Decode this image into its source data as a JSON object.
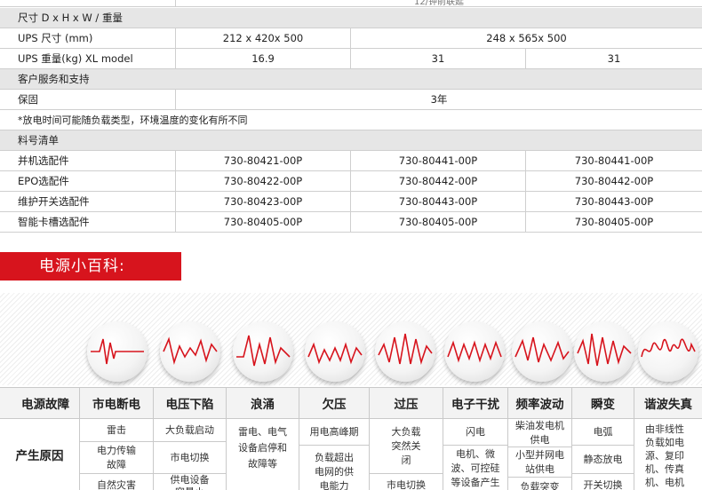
{
  "spec_table": {
    "top_partial": "12/钟前联延",
    "section_dims": "尺寸 D x H x W / 重量",
    "ups_size": {
      "label": "UPS 尺寸 (mm)",
      "v1": "212 x 420x 500",
      "v2": "248 x 565x 500"
    },
    "ups_weight": {
      "label": "UPS 重量(kg) XL model",
      "v1": "16.9",
      "v2": "31",
      "v3": "31"
    },
    "section_service": "客户服务和支持",
    "warranty": {
      "label": "保固",
      "value": "3年"
    },
    "note": "*放电时间可能随负载类型，环境温度的变化有所不同",
    "section_parts": "料号清单",
    "parts": [
      {
        "label": "并机选配件",
        "v1": "730-80421-00P",
        "v2": "730-80441-00P",
        "v3": "730-80441-00P"
      },
      {
        "label": "EPO选配件",
        "v1": "730-80422-00P",
        "v2": "730-80442-00P",
        "v3": "730-80442-00P"
      },
      {
        "label": "维护开关选配件",
        "v1": "730-80423-00P",
        "v2": "730-80443-00P",
        "v3": "730-80443-00P"
      },
      {
        "label": "智能卡槽选配件",
        "v1": "730-80405-00P",
        "v2": "730-80405-00P",
        "v3": "730-80405-00P"
      }
    ]
  },
  "banner": {
    "title": "电源小百科:"
  },
  "icons": [
    "power-outage-wave-icon",
    "voltage-sag-wave-icon",
    "surge-wave-icon",
    "undervoltage-wave-icon",
    "overvoltage-wave-icon",
    "electrical-noise-wave-icon",
    "frequency-variation-wave-icon",
    "transient-wave-icon",
    "harmonic-distortion-wave-icon"
  ],
  "fault_table": {
    "headers": [
      "电源故障",
      "市电断电",
      "电压下陷",
      "浪涌",
      "欠压",
      "过压",
      "电子干扰",
      "频率波动",
      "瞬变",
      "谐波失真"
    ],
    "row_label": "产生原因",
    "col1": [
      "雷击",
      "电力传输故障",
      "自然灾害"
    ],
    "col2": [
      "大负载启动",
      "市电切换",
      "供电设备容量小"
    ],
    "col3": "雷电、电气设备启停和故障等",
    "col4": [
      "用电高峰期",
      "负载超出电网的供电能力"
    ],
    "col5": [
      "大负载突然关闭",
      "市电切换"
    ],
    "col6": [
      "闪电",
      "电机、微波、可控硅等设备产生干扰"
    ],
    "col7": [
      "柴油发电机供电",
      "小型并网电站供电",
      "负载突变"
    ],
    "col8": [
      "电弧",
      "静态放电",
      "开关切换"
    ],
    "col9": "由非线性负载如电源、复印机、传真机、电机等引起"
  },
  "colors": {
    "accent_red": "#d7141d",
    "section_gray": "#e6e6e6"
  }
}
